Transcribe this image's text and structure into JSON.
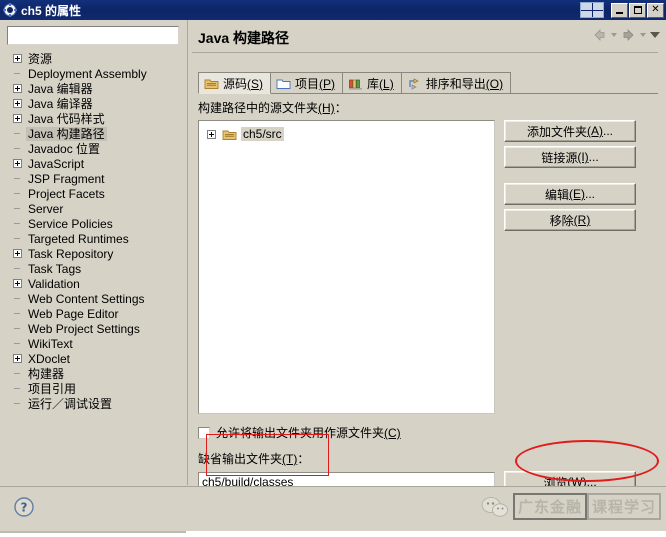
{
  "window": {
    "title": "ch5 的属性",
    "title_icon": "properties-gear-icon",
    "buttons": {
      "restore_grid": "restore-grid-icon",
      "minimize": "minimize-icon",
      "maximize": "maximize-icon",
      "close": "✕"
    }
  },
  "sidebar": {
    "filter": {
      "value": "",
      "placeholder": ""
    },
    "items": [
      {
        "label": "资源",
        "expandable": true,
        "selected": false
      },
      {
        "label": "Deployment Assembly",
        "expandable": false,
        "selected": false
      },
      {
        "label": "Java 编辑器",
        "expandable": true,
        "selected": false
      },
      {
        "label": "Java 编译器",
        "expandable": true,
        "selected": false
      },
      {
        "label": "Java 代码样式",
        "expandable": true,
        "selected": false
      },
      {
        "label": "Java 构建路径",
        "expandable": false,
        "selected": true
      },
      {
        "label": "Javadoc 位置",
        "expandable": false,
        "selected": false
      },
      {
        "label": "JavaScript",
        "expandable": true,
        "selected": false
      },
      {
        "label": "JSP Fragment",
        "expandable": false,
        "selected": false
      },
      {
        "label": "Project Facets",
        "expandable": false,
        "selected": false
      },
      {
        "label": "Server",
        "expandable": false,
        "selected": false
      },
      {
        "label": "Service Policies",
        "expandable": false,
        "selected": false
      },
      {
        "label": "Targeted Runtimes",
        "expandable": false,
        "selected": false
      },
      {
        "label": "Task Repository",
        "expandable": true,
        "selected": false
      },
      {
        "label": "Task Tags",
        "expandable": false,
        "selected": false
      },
      {
        "label": "Validation",
        "expandable": true,
        "selected": false
      },
      {
        "label": "Web Content Settings",
        "expandable": false,
        "selected": false
      },
      {
        "label": "Web Page Editor",
        "expandable": false,
        "selected": false
      },
      {
        "label": "Web Project Settings",
        "expandable": false,
        "selected": false
      },
      {
        "label": "WikiText",
        "expandable": false,
        "selected": false
      },
      {
        "label": "XDoclet",
        "expandable": true,
        "selected": false
      },
      {
        "label": "构建器",
        "expandable": false,
        "selected": false
      },
      {
        "label": "项目引用",
        "expandable": false,
        "selected": false
      },
      {
        "label": "运行／调试设置",
        "expandable": false,
        "selected": false
      }
    ]
  },
  "page": {
    "title": "Java 构建路径",
    "nav": {
      "back": "back-arrow-icon",
      "back_menu": "chevron-down-icon",
      "forward": "forward-arrow-icon",
      "forward_menu": "chevron-down-icon",
      "view_menu": "chevron-down-icon"
    }
  },
  "tabs": [
    {
      "label": "源码",
      "mnemonic": "(S)",
      "icon": "source-folder-icon",
      "active": true
    },
    {
      "label": "项目",
      "mnemonic": "(P)",
      "icon": "project-folder-icon",
      "active": false
    },
    {
      "label": "库",
      "mnemonic": "(L)",
      "icon": "library-books-icon",
      "active": false
    },
    {
      "label": "排序和导出",
      "mnemonic": "(O)",
      "icon": "order-export-icon",
      "active": false
    }
  ],
  "source_tab": {
    "list_label": "构建路径中的源文件夹",
    "list_label_mnemonic": "(H)",
    "list_label_suffix": "：",
    "entries": [
      {
        "label": "ch5/src",
        "icon": "source-folder-icon",
        "expandable": true
      }
    ],
    "buttons": [
      {
        "label": "添加文件夹",
        "mnemonic": "(A)",
        "suffix": "..."
      },
      {
        "label": "链接源",
        "mnemonic": "(I)",
        "suffix": "..."
      },
      {
        "label": "编辑",
        "mnemonic": "(E)",
        "suffix": "..."
      },
      {
        "label": "移除",
        "mnemonic": "(R)",
        "suffix": ""
      }
    ],
    "allow_output_checkbox": {
      "label": "允许将输出文件夹用作源文件夹",
      "mnemonic": "(C)",
      "checked": false
    },
    "default_output": {
      "label": "缺省输出文件夹",
      "mnemonic": "(T)",
      "suffix": "：",
      "value": "ch5/build/classes",
      "browse_button": {
        "label": "浏览",
        "mnemonic": "(W)",
        "suffix": "..."
      }
    }
  },
  "bottom": {
    "help_icon": "help-question-icon",
    "watermark": {
      "logo": "wechat-icon",
      "brand": "广东金融",
      "subtitle": "课程学习"
    }
  },
  "colors": {
    "titlebar": "#0d2566",
    "dialog_bg": "#d6d2c6",
    "field_bg": "#ffffff",
    "annotation_red": "#e01b1b",
    "selection": "#c3c0b6"
  }
}
